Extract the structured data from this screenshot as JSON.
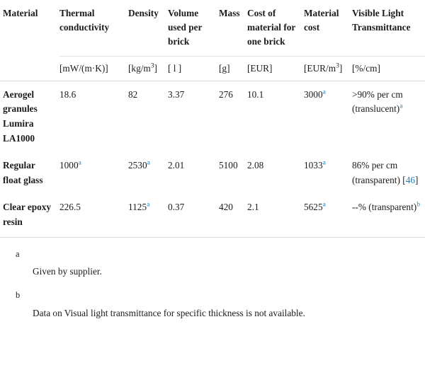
{
  "table": {
    "columns": [
      {
        "key": "material",
        "header": "Material",
        "unit": ""
      },
      {
        "key": "thermal",
        "header": "Thermal conductivity",
        "unit": "[mW/(m·K)]"
      },
      {
        "key": "density",
        "header": "Density",
        "unit": "[kg/m3]"
      },
      {
        "key": "volume",
        "header": "Volume used per brick",
        "unit": "[ l ]"
      },
      {
        "key": "mass",
        "header": "Mass",
        "unit": "[g]"
      },
      {
        "key": "cost",
        "header": "Cost of material for one brick",
        "unit": "[EUR]"
      },
      {
        "key": "matcost",
        "header": "Material cost",
        "unit": "[EUR/m3]"
      },
      {
        "key": "vlt",
        "header": "Visible Light Transmittance",
        "unit": "[%/cm]"
      }
    ],
    "unit_superscripts": {
      "density": "3",
      "matcost": "3"
    },
    "rows": [
      {
        "material": "Aerogel granules Lumira LA1000",
        "thermal": "18.6",
        "thermal_fn": "",
        "density": "82",
        "density_fn": "",
        "volume": "3.37",
        "mass": "276",
        "cost": "10.1",
        "matcost": "3000",
        "matcost_fn": "a",
        "vlt_line1": ">90% per cm",
        "vlt_line2": "(translucent)",
        "vlt_fn": "a",
        "vlt_cite": "",
        "vlt_cite_open": "",
        "vlt_cite_close": ""
      },
      {
        "material": "Regular float glass",
        "thermal": "1000",
        "thermal_fn": "a",
        "density": "2530",
        "density_fn": "a",
        "volume": "2.01",
        "mass": "5100",
        "cost": "2.08",
        "matcost": "1033",
        "matcost_fn": "a",
        "vlt_line1": "86% per cm",
        "vlt_line2": "(transparent)",
        "vlt_fn": "",
        "vlt_cite": "46",
        "vlt_cite_open": "[",
        "vlt_cite_close": "]"
      },
      {
        "material": "Clear epoxy resin",
        "thermal": "226.5",
        "thermal_fn": "",
        "density": "1125",
        "density_fn": "a",
        "volume": "0.37",
        "mass": "420",
        "cost": "2.1",
        "matcost": "5625",
        "matcost_fn": "a",
        "vlt_line1": "--%",
        "vlt_line2": "(transparent)",
        "vlt_fn": "b",
        "vlt_cite": "",
        "vlt_cite_open": "",
        "vlt_cite_close": ""
      }
    ]
  },
  "footnotes": [
    {
      "marker": "a",
      "text": "Given by supplier."
    },
    {
      "marker": "b",
      "text": "Data on Visual light transmittance for specific thickness is not available."
    }
  ],
  "colors": {
    "link": "#1e7ab8",
    "text": "#1b1b1b",
    "rule": "#d9d9dd"
  }
}
